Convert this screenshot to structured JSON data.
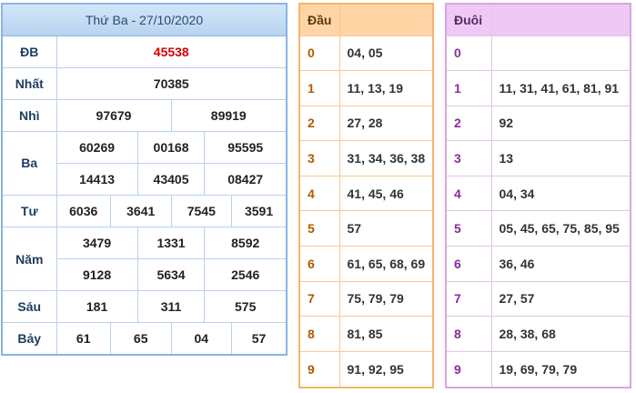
{
  "results": {
    "header": "Thứ Ba - 27/10/2020",
    "prizes": {
      "db": {
        "label": "ĐB",
        "numbers": [
          "45538"
        ]
      },
      "nhat": {
        "label": "Nhất",
        "numbers": [
          "70385"
        ]
      },
      "nhi": {
        "label": "Nhì",
        "numbers": [
          "97679",
          "89919"
        ]
      },
      "ba": {
        "label": "Ba",
        "numbers": [
          "60269",
          "00168",
          "95595",
          "14413",
          "43405",
          "08427"
        ]
      },
      "tu": {
        "label": "Tư",
        "numbers": [
          "6036",
          "3641",
          "7545",
          "3591"
        ]
      },
      "nam": {
        "label": "Năm",
        "numbers": [
          "3479",
          "1331",
          "8592",
          "9128",
          "5634",
          "2546"
        ]
      },
      "sau": {
        "label": "Sáu",
        "numbers": [
          "181",
          "311",
          "575"
        ]
      },
      "bay": {
        "label": "Bảy",
        "numbers": [
          "61",
          "65",
          "04",
          "57"
        ]
      }
    },
    "colors": {
      "special": "#d40000",
      "border": "#8ab4e2"
    }
  },
  "dau": {
    "header": "Đầu",
    "rows": [
      {
        "digit": "0",
        "values": "04, 05"
      },
      {
        "digit": "1",
        "values": "11, 13, 19"
      },
      {
        "digit": "2",
        "values": "27, 28"
      },
      {
        "digit": "3",
        "values": "31, 34, 36, 38"
      },
      {
        "digit": "4",
        "values": "41, 45, 46"
      },
      {
        "digit": "5",
        "values": "57"
      },
      {
        "digit": "6",
        "values": "61, 65, 68, 69"
      },
      {
        "digit": "7",
        "values": "75, 79, 79"
      },
      {
        "digit": "8",
        "values": "81, 85"
      },
      {
        "digit": "9",
        "values": "91, 92, 95"
      }
    ],
    "colors": {
      "border": "#f6b46b",
      "header_bg": "#ffd5a6"
    }
  },
  "duoi": {
    "header": "Đuôi",
    "rows": [
      {
        "digit": "0",
        "values": ""
      },
      {
        "digit": "1",
        "values": "11, 31, 41, 61, 81, 91"
      },
      {
        "digit": "2",
        "values": "92"
      },
      {
        "digit": "3",
        "values": "13"
      },
      {
        "digit": "4",
        "values": "04, 34"
      },
      {
        "digit": "5",
        "values": "05, 45, 65, 75, 85, 95"
      },
      {
        "digit": "6",
        "values": "36, 46"
      },
      {
        "digit": "7",
        "values": "27, 57"
      },
      {
        "digit": "8",
        "values": "28, 38, 68"
      },
      {
        "digit": "9",
        "values": "19, 69, 79, 79"
      }
    ],
    "colors": {
      "border": "#d8a6e2",
      "header_bg": "#efc8f5"
    }
  }
}
